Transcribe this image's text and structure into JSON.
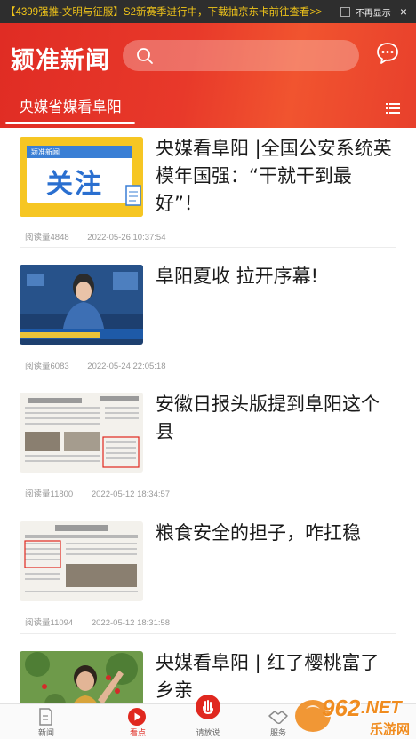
{
  "ad": {
    "text": "【4399强推-文明与征服】S2新赛季进行中，下载抽京东卡前往查看>>",
    "hide_label": "不再显示",
    "close_glyph": "×"
  },
  "header": {
    "logo": "颍准新闻",
    "search_placeholder": "",
    "active_tab": "央媒省媒看阜阳",
    "icons": [
      "search-icon",
      "message-icon",
      "menu-icon"
    ]
  },
  "articles": [
    {
      "title": "央媒看阜阳 |全国公安系统英模年国强：“干就干到最好”！",
      "reads": "阅读量4848",
      "date": "2022-05-26 10:37:54",
      "thumb_caption": "关注",
      "thumb_brand": "颍准新闻"
    },
    {
      "title": "阜阳夏收 拉开序幕!",
      "reads": "阅读量6083",
      "date": "2022-05-24 22:05:18"
    },
    {
      "title": "安徽日报头版提到阜阳这个县",
      "reads": "阅读量11800",
      "date": "2022-05-12 18:34:57"
    },
    {
      "title": "粮食安全的担子，咋扛稳",
      "reads": "阅读量11094",
      "date": "2022-05-12 18:31:58"
    },
    {
      "title": "央媒看阜阳 | 红了樱桃富了乡亲",
      "reads": "",
      "date": ""
    }
  ],
  "bottom_nav": [
    {
      "label": "新闻",
      "icon": "news-icon",
      "active": false
    },
    {
      "label": "看点",
      "icon": "play-icon",
      "active": true
    },
    {
      "label": "请放说",
      "icon": "hand-icon",
      "active": false
    },
    {
      "label": "服务",
      "icon": "handshake-icon",
      "active": false
    }
  ],
  "watermark": {
    "number": "962",
    "net": ".NET",
    "site": "乐游网"
  },
  "colors": {
    "brand_red": "#e0281f",
    "ad_text": "#f0c419"
  }
}
